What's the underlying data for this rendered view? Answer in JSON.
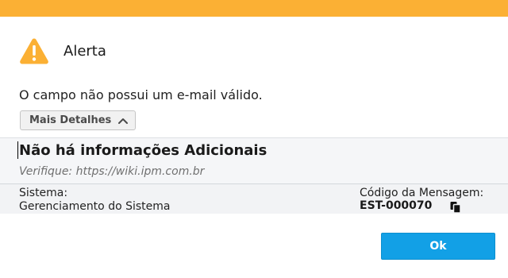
{
  "colors": {
    "top_bar": "#FBB034",
    "warning_icon": "#FBB034",
    "ok_button": "#12A0E6"
  },
  "dialog": {
    "title": "Alerta",
    "icon": "warning-triangle-icon",
    "message": "O campo não possui um e-mail válido.",
    "details_button_label": "Mais Detalhes"
  },
  "details": {
    "heading": "Não há informações Adicionais",
    "verify_text": "Verifique: https://wiki.ipm.com.br",
    "system_label": "Sistema:",
    "system_value": "Gerenciamento do Sistema",
    "code_label": "Código da Mensagem:",
    "code_value": "EST-000070",
    "copy_icon": "copy-icon"
  },
  "footer": {
    "ok_label": "Ok"
  }
}
